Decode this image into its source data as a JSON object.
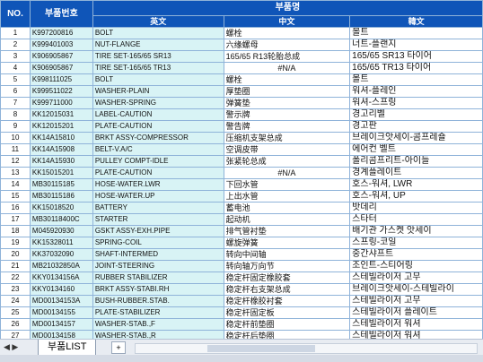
{
  "headers": {
    "no": "NO.",
    "part_no": "부품번호",
    "part_name": "부품명",
    "english": "英文",
    "chinese": "中文",
    "korean": "韓文"
  },
  "rows": [
    {
      "no": "1",
      "part": "K997200816",
      "en": "BOLT",
      "cn": "螺栓",
      "kr": "볼트"
    },
    {
      "no": "2",
      "part": "K999401003",
      "en": "NUT-FLANGE",
      "cn": "六缘螺母",
      "kr": "너트-플랜지"
    },
    {
      "no": "3",
      "part": "K906905867",
      "en": "TIRE SET-165/65 SR13",
      "cn": "165/65 R13轮胎总成",
      "kr": "165/65 SR13 타이어"
    },
    {
      "no": "4",
      "part": "K906905867",
      "en": "TIRE SET-165/65 TR13",
      "cn": "#N/A",
      "kr": "165/65 TR13 타이어"
    },
    {
      "no": "5",
      "part": "K998111025",
      "en": "BOLT",
      "cn": "螺栓",
      "kr": "볼트"
    },
    {
      "no": "6",
      "part": "K999511022",
      "en": "WASHER-PLAIN",
      "cn": "厚垫圈",
      "kr": "워셔-플레인"
    },
    {
      "no": "7",
      "part": "K999711000",
      "en": "WASHER-SPRING",
      "cn": "弹簧垫",
      "kr": "워셔-스프링"
    },
    {
      "no": "8",
      "part": "KK12015031",
      "en": "LABEL-CAUTION",
      "cn": "警示牌",
      "kr": "경고리벨"
    },
    {
      "no": "9",
      "part": "KK12015201",
      "en": "PLATE-CAUTION",
      "cn": "警告牌",
      "kr": "경고판"
    },
    {
      "no": "10",
      "part": "KK14A15810",
      "en": "BRKT ASSY-COMPRESSOR",
      "cn": "压缩机支架总成",
      "kr": "브레이크앗세이-콤프레숄"
    },
    {
      "no": "11",
      "part": "KK14A15908",
      "en": "BELT-V.A/C",
      "cn": "空调皮带",
      "kr": "에어컨 벨트"
    },
    {
      "no": "12",
      "part": "KK14A15930",
      "en": "PULLEY COMPT-IDLE",
      "cn": "张紧轮总成",
      "kr": "폴리콤프리트-아이들"
    },
    {
      "no": "13",
      "part": "KK15015201",
      "en": "PLATE-CAUTION",
      "cn": "#N/A",
      "kr": "경계플레이트"
    },
    {
      "no": "14",
      "part": "MB30115185",
      "en": "HOSE-WATER.LWR",
      "cn": "下回水管",
      "kr": "호스-워셔, LWR"
    },
    {
      "no": "15",
      "part": "MB30115186",
      "en": "HOSE-WATER.UP",
      "cn": "上出水管",
      "kr": "호스-워셔, UP"
    },
    {
      "no": "16",
      "part": "KK15018520",
      "en": "BATTERY",
      "cn": "蓄电池",
      "kr": "밧데리"
    },
    {
      "no": "17",
      "part": "MB30118400C",
      "en": "STARTER",
      "cn": "起动机",
      "kr": "스타터"
    },
    {
      "no": "18",
      "part": "M045920930",
      "en": "GSKT ASSY-EXH.PIPE",
      "cn": "排气管衬垫",
      "kr": "배기관 가스켓 앗세이"
    },
    {
      "no": "19",
      "part": "KK15328011",
      "en": "SPRING-COIL",
      "cn": "螺旋弹簧",
      "kr": "스프링-코일"
    },
    {
      "no": "20",
      "part": "KK37032090",
      "en": "SHAFT-INTERMED",
      "cn": "转向中间轴",
      "kr": "중간샤프트"
    },
    {
      "no": "21",
      "part": "MB21032850A",
      "en": "JOINT-STEERING",
      "cn": "转向轴万向节",
      "kr": "조인트-스티어링"
    },
    {
      "no": "22",
      "part": "KKY0134156A",
      "en": "RUBBER STABILIZER",
      "cn": "稳定杆固定橡胶套",
      "kr": "스테빌라이저 고무"
    },
    {
      "no": "23",
      "part": "KKY0134160",
      "en": "BRKT ASSY-STABI.RH",
      "cn": "稳定杆右支架总成",
      "kr": "브레이크앗세이-스테빌라이"
    },
    {
      "no": "24",
      "part": "MD00134153A",
      "en": "BUSH-RUBBER.STAB.",
      "cn": "稳定杆橡胶衬套",
      "kr": "스테빌라이저 고무"
    },
    {
      "no": "25",
      "part": "MD00134155",
      "en": "PLATE-STABILIZER",
      "cn": "稳定杆固定板",
      "kr": "스테빌라이저 플레이트"
    },
    {
      "no": "26",
      "part": "MD00134157",
      "en": "WASHER-STAB.,F",
      "cn": "稳定杆前垫圈",
      "kr": "스테빌라이저 워셔"
    },
    {
      "no": "27",
      "part": "MD00134158",
      "en": "WASHER-STAB.,R",
      "cn": "稳定杆后垫圈",
      "kr": "스테빌라이저 워셔"
    }
  ],
  "footer": {
    "sheet_tab": "부품LIST",
    "nav_arrows": "◀ ▶",
    "new_tab_icon": "+"
  }
}
